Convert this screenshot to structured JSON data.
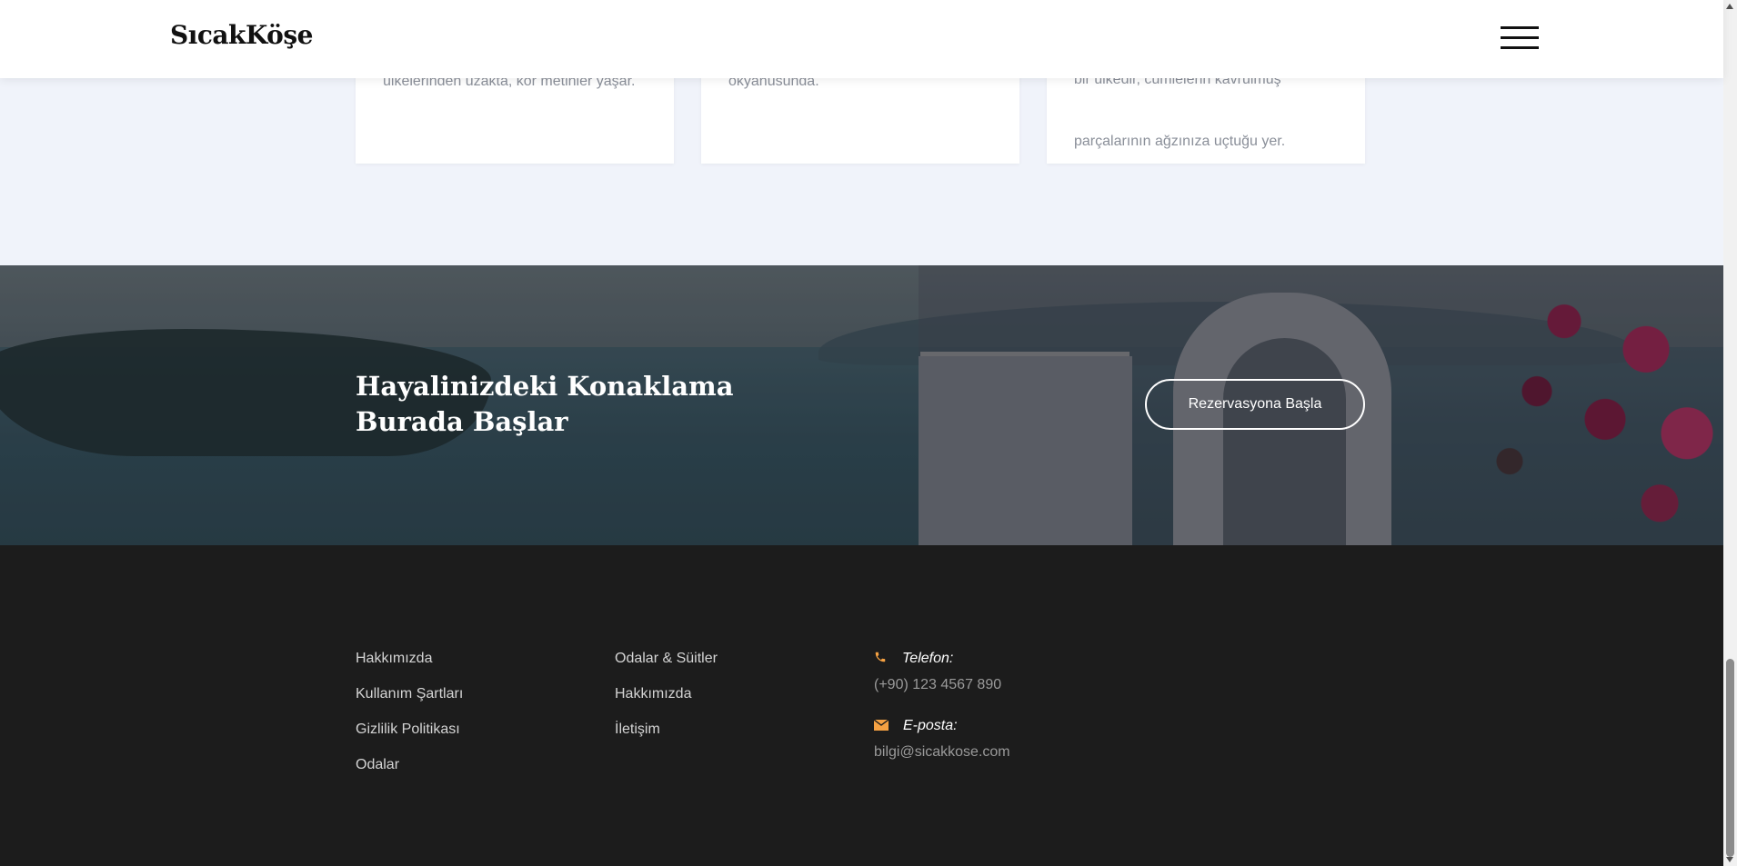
{
  "header": {
    "logo": "SıcakKöşe",
    "menu_icon": "hamburger-menu-icon"
  },
  "cards": [
    {
      "lines": [
        "ülkelerinden uzakta, kör metinler yaşar."
      ]
    },
    {
      "lines": [
        "okyanusunda."
      ]
    },
    {
      "lines": [
        "bir ülkedir, cümlelerin kavrulmuş",
        "parçalarının ağzınıza uçtuğu yer."
      ]
    }
  ],
  "cta": {
    "title": "Hayalinizdeki Konaklama Burada Başlar",
    "button_label": "Rezervasyona Başla"
  },
  "footer": {
    "column1": [
      "Hakkımızda",
      "Kullanım Şartları",
      "Gizlilik Politikası",
      "Odalar"
    ],
    "column2": [
      "Odalar & Süitler",
      "Hakkımızda",
      "İletişim"
    ],
    "contact": {
      "phone_label": "Telefon:",
      "phone_value": "(+90) 123 4567 890",
      "email_label": "E-posta:",
      "email_value": "bilgi@sicakkose.com",
      "phone_icon": "phone-icon",
      "email_icon": "envelope-icon",
      "icon_color": "#f5a142"
    }
  }
}
